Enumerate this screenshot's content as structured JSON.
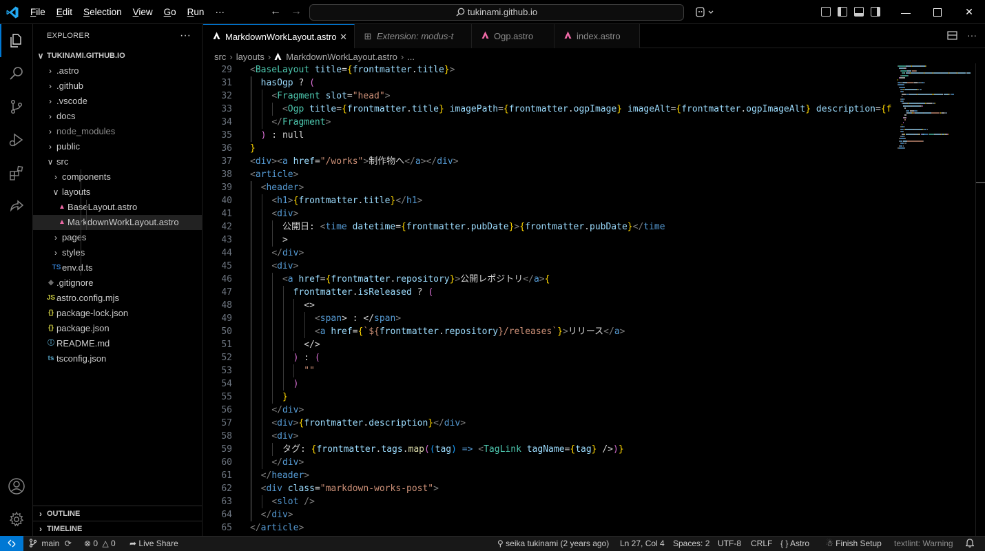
{
  "menu": [
    {
      "u": "F",
      "rest": "ile"
    },
    {
      "u": "E",
      "rest": "dit"
    },
    {
      "u": "S",
      "rest": "election"
    },
    {
      "u": "V",
      "rest": "iew"
    },
    {
      "u": "G",
      "rest": "o"
    },
    {
      "u": "R",
      "rest": "un"
    }
  ],
  "menu_more": "···",
  "search_text": "tukinami.github.io",
  "sidebar": {
    "title": "EXPLORER",
    "more": "···",
    "root": "TUKINAMI.GITHUB.IO",
    "outline": "OUTLINE",
    "timeline": "TIMELINE"
  },
  "tree": [
    {
      "label": ".astro",
      "depth": 0,
      "kind": "folder",
      "open": false,
      "dim": false
    },
    {
      "label": ".github",
      "depth": 0,
      "kind": "folder",
      "open": false,
      "dim": false
    },
    {
      "label": ".vscode",
      "depth": 0,
      "kind": "folder",
      "open": false,
      "dim": false
    },
    {
      "label": "docs",
      "depth": 0,
      "kind": "folder",
      "open": false,
      "dim": false
    },
    {
      "label": "node_modules",
      "depth": 0,
      "kind": "folder",
      "open": false,
      "dim": true
    },
    {
      "label": "public",
      "depth": 0,
      "kind": "folder",
      "open": false,
      "dim": false
    },
    {
      "label": "src",
      "depth": 0,
      "kind": "folder",
      "open": true,
      "dim": false
    },
    {
      "label": "components",
      "depth": 1,
      "kind": "folder",
      "open": false,
      "dim": false
    },
    {
      "label": "layouts",
      "depth": 1,
      "kind": "folder",
      "open": true,
      "dim": false
    },
    {
      "label": "BaseLayout.astro",
      "depth": 2,
      "kind": "astro",
      "dim": false
    },
    {
      "label": "MarkdownWorkLayout.astro",
      "depth": 2,
      "kind": "astro",
      "dim": false,
      "selected": true
    },
    {
      "label": "pages",
      "depth": 1,
      "kind": "folder",
      "open": false,
      "dim": false
    },
    {
      "label": "styles",
      "depth": 1,
      "kind": "folder",
      "open": false,
      "dim": false
    },
    {
      "label": "env.d.ts",
      "depth": 1,
      "kind": "ts",
      "dim": false
    },
    {
      "label": ".gitignore",
      "depth": 0,
      "kind": "git",
      "dim": false
    },
    {
      "label": "astro.config.mjs",
      "depth": 0,
      "kind": "js",
      "dim": false
    },
    {
      "label": "package-lock.json",
      "depth": 0,
      "kind": "json",
      "dim": false
    },
    {
      "label": "package.json",
      "depth": 0,
      "kind": "json",
      "dim": false
    },
    {
      "label": "README.md",
      "depth": 0,
      "kind": "info",
      "dim": false
    },
    {
      "label": "tsconfig.json",
      "depth": 0,
      "kind": "tsconfig",
      "dim": false
    }
  ],
  "tabs": [
    {
      "label": "MarkdownWorkLayout.astro",
      "kind": "astro",
      "active": true,
      "close": "✕"
    },
    {
      "label": "Extension: modus-t",
      "kind": "ext",
      "active": false,
      "preview": true
    },
    {
      "label": "Ogp.astro",
      "kind": "astro",
      "active": false
    },
    {
      "label": "index.astro",
      "kind": "astro",
      "active": false
    }
  ],
  "breadcrumb": [
    "src",
    "layouts",
    "MarkdownWorkLayout.astro",
    "..."
  ],
  "code_lines": [
    {
      "n": 29,
      "i": 0,
      "t": [
        [
          "<",
          "b"
        ],
        [
          "BaseLayout",
          "c"
        ],
        [
          " ",
          "w"
        ],
        [
          "title",
          "a"
        ],
        [
          "=",
          "w"
        ],
        [
          "{",
          "y"
        ],
        [
          "frontmatter",
          "a"
        ],
        [
          ".",
          "w"
        ],
        [
          "title",
          "a"
        ],
        [
          "}",
          "y"
        ],
        [
          ">",
          "b"
        ]
      ]
    },
    {
      "n": 31,
      "i": 1,
      "t": [
        [
          "hasOgp",
          "a"
        ],
        [
          " ",
          "w"
        ],
        [
          "?",
          "w"
        ],
        [
          " ",
          "w"
        ],
        [
          "(",
          "p"
        ]
      ]
    },
    {
      "n": 32,
      "i": 2,
      "t": [
        [
          "<",
          "b"
        ],
        [
          "Fragment",
          "c"
        ],
        [
          " ",
          "w"
        ],
        [
          "slot",
          "a"
        ],
        [
          "=",
          "w"
        ],
        [
          "\"head\"",
          "s"
        ],
        [
          ">",
          "b"
        ]
      ]
    },
    {
      "n": 33,
      "i": 3,
      "t": [
        [
          "<",
          "b"
        ],
        [
          "Ogp",
          "c"
        ],
        [
          " ",
          "w"
        ],
        [
          "title",
          "a"
        ],
        [
          "=",
          "w"
        ],
        [
          "{",
          "y"
        ],
        [
          "frontmatter",
          "a"
        ],
        [
          ".",
          "w"
        ],
        [
          "title",
          "a"
        ],
        [
          "}",
          "y"
        ],
        [
          " ",
          "w"
        ],
        [
          "imagePath",
          "a"
        ],
        [
          "=",
          "w"
        ],
        [
          "{",
          "y"
        ],
        [
          "frontmatter",
          "a"
        ],
        [
          ".",
          "w"
        ],
        [
          "ogpImage",
          "a"
        ],
        [
          "}",
          "y"
        ],
        [
          " ",
          "w"
        ],
        [
          "imageAlt",
          "a"
        ],
        [
          "=",
          "w"
        ],
        [
          "{",
          "y"
        ],
        [
          "frontmatter",
          "a"
        ],
        [
          ".",
          "w"
        ],
        [
          "ogpImageAlt",
          "a"
        ],
        [
          "}",
          "y"
        ],
        [
          " ",
          "w"
        ],
        [
          "description",
          "a"
        ],
        [
          "=",
          "w"
        ],
        [
          "{f",
          "y"
        ]
      ]
    },
    {
      "n": 34,
      "i": 2,
      "t": [
        [
          "</",
          "b"
        ],
        [
          "Fragment",
          "c"
        ],
        [
          ">",
          "b"
        ]
      ]
    },
    {
      "n": 35,
      "i": 1,
      "t": [
        [
          ")",
          "p"
        ],
        [
          " : ",
          "w"
        ],
        [
          "null",
          "w"
        ]
      ]
    },
    {
      "n": 36,
      "i": 0,
      "t": [
        [
          "}",
          "y"
        ]
      ]
    },
    {
      "n": 37,
      "i": 0,
      "t": [
        [
          "<",
          "b"
        ],
        [
          "div",
          "k"
        ],
        [
          "><",
          "b"
        ],
        [
          "a",
          "k"
        ],
        [
          " ",
          "w"
        ],
        [
          "href",
          "a"
        ],
        [
          "=",
          "w"
        ],
        [
          "\"/works\"",
          "s"
        ],
        [
          ">",
          "b"
        ],
        [
          "制作物へ",
          "w"
        ],
        [
          "</",
          "b"
        ],
        [
          "a",
          "k"
        ],
        [
          "></",
          "b"
        ],
        [
          "div",
          "k"
        ],
        [
          ">",
          "b"
        ]
      ]
    },
    {
      "n": 38,
      "i": 0,
      "t": [
        [
          "<",
          "b"
        ],
        [
          "article",
          "k"
        ],
        [
          ">",
          "b"
        ]
      ]
    },
    {
      "n": 39,
      "i": 1,
      "t": [
        [
          "<",
          "b"
        ],
        [
          "header",
          "k"
        ],
        [
          ">",
          "b"
        ]
      ]
    },
    {
      "n": 40,
      "i": 2,
      "t": [
        [
          "<",
          "b"
        ],
        [
          "h1",
          "k"
        ],
        [
          ">",
          "b"
        ],
        [
          "{",
          "y"
        ],
        [
          "frontmatter",
          "a"
        ],
        [
          ".",
          "w"
        ],
        [
          "title",
          "a"
        ],
        [
          "}",
          "y"
        ],
        [
          "</",
          "b"
        ],
        [
          "h1",
          "k"
        ],
        [
          ">",
          "b"
        ]
      ]
    },
    {
      "n": 41,
      "i": 2,
      "t": [
        [
          "<",
          "b"
        ],
        [
          "div",
          "k"
        ],
        [
          ">",
          "b"
        ]
      ]
    },
    {
      "n": 42,
      "i": 3,
      "t": [
        [
          "公開日: ",
          "w"
        ],
        [
          "<",
          "b"
        ],
        [
          "time",
          "k"
        ],
        [
          " ",
          "w"
        ],
        [
          "datetime",
          "a"
        ],
        [
          "=",
          "w"
        ],
        [
          "{",
          "y"
        ],
        [
          "frontmatter",
          "a"
        ],
        [
          ".",
          "w"
        ],
        [
          "pubDate",
          "a"
        ],
        [
          "}",
          "y"
        ],
        [
          ">",
          "b"
        ],
        [
          "{",
          "y"
        ],
        [
          "frontmatter",
          "a"
        ],
        [
          ".",
          "w"
        ],
        [
          "pubDate",
          "a"
        ],
        [
          "}",
          "y"
        ],
        [
          "</",
          "b"
        ],
        [
          "time",
          "k"
        ]
      ]
    },
    {
      "n": 43,
      "i": 3,
      "t": [
        [
          ">",
          "w"
        ]
      ]
    },
    {
      "n": 44,
      "i": 2,
      "t": [
        [
          "</",
          "b"
        ],
        [
          "div",
          "k"
        ],
        [
          ">",
          "b"
        ]
      ]
    },
    {
      "n": 45,
      "i": 2,
      "t": [
        [
          "<",
          "b"
        ],
        [
          "div",
          "k"
        ],
        [
          ">",
          "b"
        ]
      ]
    },
    {
      "n": 46,
      "i": 3,
      "t": [
        [
          "<",
          "b"
        ],
        [
          "a",
          "k"
        ],
        [
          " ",
          "w"
        ],
        [
          "href",
          "a"
        ],
        [
          "=",
          "w"
        ],
        [
          "{",
          "y"
        ],
        [
          "frontmatter",
          "a"
        ],
        [
          ".",
          "w"
        ],
        [
          "repository",
          "a"
        ],
        [
          "}",
          "y"
        ],
        [
          ">",
          "b"
        ],
        [
          "公開レポジトリ",
          "w"
        ],
        [
          "</",
          "b"
        ],
        [
          "a",
          "k"
        ],
        [
          ">",
          "b"
        ],
        [
          "{",
          "y"
        ]
      ]
    },
    {
      "n": 47,
      "i": 4,
      "t": [
        [
          "frontmatter",
          "a"
        ],
        [
          ".",
          "w"
        ],
        [
          "isReleased",
          "a"
        ],
        [
          " ",
          "w"
        ],
        [
          "?",
          "w"
        ],
        [
          " ",
          "w"
        ],
        [
          "(",
          "p"
        ]
      ]
    },
    {
      "n": 48,
      "i": 5,
      "t": [
        [
          "<>",
          "w"
        ]
      ]
    },
    {
      "n": 49,
      "i": 6,
      "t": [
        [
          "<",
          "b"
        ],
        [
          "span",
          "k"
        ],
        [
          "> : </",
          "w"
        ],
        [
          "span",
          "k"
        ],
        [
          ">",
          "b"
        ]
      ]
    },
    {
      "n": 50,
      "i": 6,
      "t": [
        [
          "<",
          "b"
        ],
        [
          "a",
          "k"
        ],
        [
          " ",
          "w"
        ],
        [
          "href",
          "a"
        ],
        [
          "=",
          "w"
        ],
        [
          "{",
          "y"
        ],
        [
          "`${",
          "s"
        ],
        [
          "frontmatter",
          "a"
        ],
        [
          ".",
          "w"
        ],
        [
          "repository",
          "a"
        ],
        [
          "}/releases`",
          "s"
        ],
        [
          "}",
          "y"
        ],
        [
          ">",
          "b"
        ],
        [
          "リリース",
          "w"
        ],
        [
          "</",
          "b"
        ],
        [
          "a",
          "k"
        ],
        [
          ">",
          "b"
        ]
      ]
    },
    {
      "n": 51,
      "i": 5,
      "t": [
        [
          "</>",
          "w"
        ]
      ]
    },
    {
      "n": 52,
      "i": 4,
      "t": [
        [
          ")",
          "p"
        ],
        [
          " : ",
          "w"
        ],
        [
          "(",
          "p"
        ]
      ]
    },
    {
      "n": 53,
      "i": 5,
      "t": [
        [
          "\"\"",
          "s"
        ]
      ]
    },
    {
      "n": 54,
      "i": 4,
      "t": [
        [
          ")",
          "p"
        ]
      ]
    },
    {
      "n": 55,
      "i": 3,
      "t": [
        [
          "}",
          "y"
        ]
      ]
    },
    {
      "n": 56,
      "i": 2,
      "t": [
        [
          "</",
          "b"
        ],
        [
          "div",
          "k"
        ],
        [
          ">",
          "b"
        ]
      ]
    },
    {
      "n": 57,
      "i": 2,
      "t": [
        [
          "<",
          "b"
        ],
        [
          "div",
          "k"
        ],
        [
          ">",
          "b"
        ],
        [
          "{",
          "y"
        ],
        [
          "frontmatter",
          "a"
        ],
        [
          ".",
          "w"
        ],
        [
          "description",
          "a"
        ],
        [
          "}",
          "y"
        ],
        [
          "</",
          "b"
        ],
        [
          "div",
          "k"
        ],
        [
          ">",
          "b"
        ]
      ]
    },
    {
      "n": 58,
      "i": 2,
      "t": [
        [
          "<",
          "b"
        ],
        [
          "div",
          "k"
        ],
        [
          ">",
          "b"
        ]
      ]
    },
    {
      "n": 59,
      "i": 3,
      "t": [
        [
          "タグ: ",
          "w"
        ],
        [
          "{",
          "y"
        ],
        [
          "frontmatter",
          "a"
        ],
        [
          ".",
          "w"
        ],
        [
          "tags",
          "a"
        ],
        [
          ".",
          "w"
        ],
        [
          "map",
          "f"
        ],
        [
          "(",
          "p"
        ],
        [
          "(",
          "b2"
        ],
        [
          "tag",
          "a"
        ],
        [
          ")",
          "b2"
        ],
        [
          " => ",
          "k"
        ],
        [
          "<",
          "b"
        ],
        [
          "TagLink",
          "c"
        ],
        [
          " ",
          "w"
        ],
        [
          "tagName",
          "a"
        ],
        [
          "=",
          "w"
        ],
        [
          "{",
          "y"
        ],
        [
          "tag",
          "a"
        ],
        [
          "}",
          "y"
        ],
        [
          " />",
          "w"
        ],
        [
          ")",
          "p"
        ],
        [
          "}",
          "y"
        ]
      ]
    },
    {
      "n": 60,
      "i": 2,
      "t": [
        [
          "</",
          "b"
        ],
        [
          "div",
          "k"
        ],
        [
          ">",
          "b"
        ]
      ]
    },
    {
      "n": 61,
      "i": 1,
      "t": [
        [
          "</",
          "b"
        ],
        [
          "header",
          "k"
        ],
        [
          ">",
          "b"
        ]
      ]
    },
    {
      "n": 62,
      "i": 1,
      "t": [
        [
          "<",
          "b"
        ],
        [
          "div",
          "k"
        ],
        [
          " ",
          "w"
        ],
        [
          "class",
          "a"
        ],
        [
          "=",
          "w"
        ],
        [
          "\"markdown-works-post\"",
          "s"
        ],
        [
          ">",
          "b"
        ]
      ]
    },
    {
      "n": 63,
      "i": 2,
      "t": [
        [
          "<",
          "b"
        ],
        [
          "slot",
          "k"
        ],
        [
          " />",
          "b"
        ]
      ]
    },
    {
      "n": 64,
      "i": 1,
      "t": [
        [
          "</",
          "b"
        ],
        [
          "div",
          "k"
        ],
        [
          ">",
          "b"
        ]
      ]
    },
    {
      "n": 65,
      "i": 0,
      "t": [
        [
          "</",
          "b"
        ],
        [
          "article",
          "k"
        ],
        [
          ">",
          "b"
        ]
      ]
    }
  ],
  "syntax_colors": {
    "b": "#808080",
    "k": "#569cd6",
    "c": "#4ec9b0",
    "a": "#9cdcfe",
    "s": "#ce9178",
    "y": "#ffd700",
    "p": "#da70d6",
    "b2": "#179fff",
    "f": "#dcdcaa",
    "w": "#d4d4d4"
  },
  "status": {
    "branch": "main",
    "errors": "0",
    "warnings": "0",
    "live_share": "Live Share",
    "blame": "seika tukinami (2 years ago)",
    "position": "Ln 27, Col 4",
    "spaces": "Spaces: 2",
    "encoding": "UTF-8",
    "eol": "CRLF",
    "language": "Astro",
    "finish_setup": "Finish Setup",
    "textlint": "textlint: Warning"
  }
}
